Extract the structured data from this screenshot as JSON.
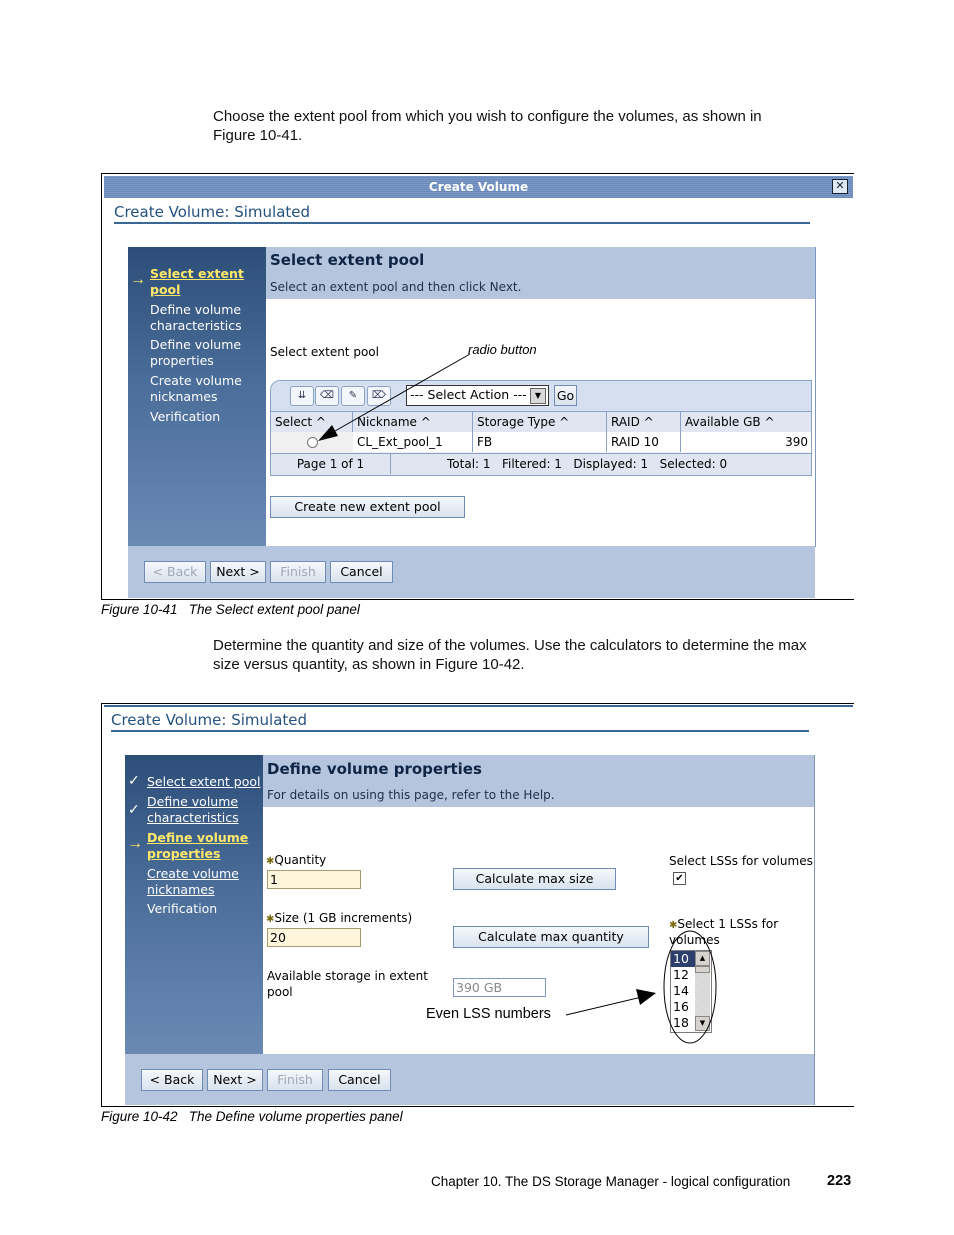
{
  "intro_paragraph": "Choose the extent pool from which you wish to configure the volumes, as shown in Figure 10-41.",
  "intro_line1": "Choose the extent pool from which you wish to configure the volumes, as shown in",
  "intro_line2": "Figure 10-41.",
  "figure1": {
    "window_title": "Create Volume",
    "close_icon": "close-icon",
    "wizard_title": "Create Volume: Simulated",
    "steps": [
      {
        "label_line1": "Select extent",
        "label_line2": "pool",
        "state": "current",
        "icon": "arrow-right-icon"
      },
      {
        "label_line1": "Define volume",
        "label_line2": "characteristics",
        "state": "pending"
      },
      {
        "label_line1": "Define volume",
        "label_line2": "properties",
        "state": "pending"
      },
      {
        "label_line1": "Create volume",
        "label_line2": "nicknames",
        "state": "pending"
      },
      {
        "label_line1": "Verification",
        "label_line2": "",
        "state": "pending"
      }
    ],
    "panel_title": "Select extent pool",
    "panel_subtitle": "Select an extent pool and then click Next.",
    "section_label": "Select extent pool",
    "toolbar_icons": [
      "select-all-icon",
      "deselect-all-icon",
      "edit-icon",
      "clear-icon"
    ],
    "action_select": {
      "value": "--- Select Action ---"
    },
    "go_label": "Go",
    "table": {
      "columns": [
        "Select ^",
        "Nickname ^",
        "Storage Type ^",
        "RAID ^",
        "Available GB ^"
      ],
      "rows": [
        {
          "select": "radio",
          "nickname": "CL_Ext_pool_1",
          "storage_type": "FB",
          "raid": "RAID 10",
          "available_gb": "390"
        }
      ],
      "footer": {
        "page": "Page 1 of 1",
        "total": "Total: 1",
        "filtered": "Filtered: 1",
        "displayed": "Displayed: 1",
        "selected": "Selected: 0"
      }
    },
    "create_pool_button": "Create new extent pool",
    "nav_buttons": {
      "back": "< Back",
      "next": "Next >",
      "finish": "Finish",
      "cancel": "Cancel"
    },
    "annotation": "radio button",
    "caption": "Figure 10-41   The Select extent pool panel"
  },
  "middle_line1": "Determine the quantity and size of the volumes. Use the calculators to determine the max",
  "middle_line2": "size versus quantity, as shown in Figure 10-42.",
  "figure2": {
    "wizard_title": "Create Volume: Simulated",
    "steps": [
      {
        "label_line1": "Select extent pool",
        "label_line2": "",
        "state": "done",
        "icon": "checkmark-icon"
      },
      {
        "label_line1": "Define volume",
        "label_line2": "characteristics",
        "state": "done",
        "icon": "checkmark-icon"
      },
      {
        "label_line1": "Define volume",
        "label_line2": "properties",
        "state": "current",
        "icon": "arrow-right-icon"
      },
      {
        "label_line1": "Create volume",
        "label_line2": "nicknames",
        "state": "link"
      },
      {
        "label_line1": "Verification",
        "label_line2": "",
        "state": "pending"
      }
    ],
    "panel_title": "Define volume properties",
    "panel_subtitle": "For details on using this page, refer to the Help.",
    "quantity": {
      "label": "Quantity",
      "value": "1",
      "required": true
    },
    "size": {
      "label": "Size (1 GB increments)",
      "value": "20",
      "required": true
    },
    "available": {
      "label_line1": "Available storage in extent",
      "label_line2": "pool",
      "value": "390 GB"
    },
    "calc_max_size": "Calculate max size",
    "calc_max_quantity": "Calculate max quantity",
    "select_lss_checkbox": {
      "label": "Select LSSs for volumes",
      "checked": true
    },
    "lss_list": {
      "label_line1": "Select 1 LSSs for",
      "label_line2": "volumes",
      "items": [
        "10",
        "12",
        "14",
        "16",
        "18"
      ],
      "selected": "10"
    },
    "nav_buttons": {
      "back": "< Back",
      "next": "Next >",
      "finish": "Finish",
      "cancel": "Cancel"
    },
    "annotation": "Even LSS numbers",
    "caption": "Figure 10-42   The Define volume properties panel"
  },
  "page_footer": {
    "chapter": "Chapter 10. The DS Storage Manager - logical configuration",
    "page_number": "223"
  }
}
